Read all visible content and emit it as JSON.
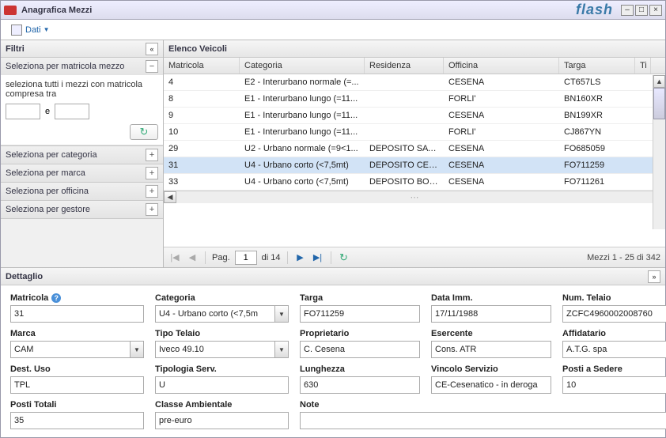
{
  "window": {
    "title": "Anagrafica Mezzi",
    "brand": "flash"
  },
  "toolbar": {
    "dati_label": "Dati"
  },
  "filters": {
    "header": "Filtri",
    "sections": {
      "matricola": {
        "label": "Seleziona per matricola mezzo",
        "desc": "seleziona tutti i mezzi con matricola compresa tra",
        "sep": "e",
        "from": "",
        "to": ""
      },
      "categoria": {
        "label": "Seleziona per categoria"
      },
      "marca": {
        "label": "Seleziona per marca"
      },
      "officina": {
        "label": "Seleziona per officina"
      },
      "gestore": {
        "label": "Seleziona per gestore"
      }
    }
  },
  "grid": {
    "header": "Elenco Veicoli",
    "columns": {
      "matricola": "Matricola",
      "categoria": "Categoria",
      "residenza": "Residenza",
      "officina": "Officina",
      "targa": "Targa",
      "ti": "Ti"
    },
    "rows": [
      {
        "matricola": "4",
        "categoria": "E2 - Interurbano normale (=...",
        "residenza": "",
        "officina": "CESENA",
        "targa": "CT657LS"
      },
      {
        "matricola": "8",
        "categoria": "E1 - Interurbano lungo (=11...",
        "residenza": "",
        "officina": "FORLI'",
        "targa": "BN160XR"
      },
      {
        "matricola": "9",
        "categoria": "E1 - Interurbano lungo (=11...",
        "residenza": "",
        "officina": "CESENA",
        "targa": "BN199XR"
      },
      {
        "matricola": "10",
        "categoria": "E1 - Interurbano lungo (=11...",
        "residenza": "",
        "officina": "FORLI'",
        "targa": "CJ867YN"
      },
      {
        "matricola": "29",
        "categoria": "U2 - Urbano normale (=9<1...",
        "residenza": "DEPOSITO SAVI...",
        "officina": "CESENA",
        "targa": "FO685059"
      },
      {
        "matricola": "31",
        "categoria": "U4 - Urbano corto (<7,5mt)",
        "residenza": "DEPOSITO CESE...",
        "officina": "CESENA",
        "targa": "FO711259"
      },
      {
        "matricola": "33",
        "categoria": "U4 - Urbano corto (<7,5mt)",
        "residenza": "DEPOSITO BORE...",
        "officina": "CESENA",
        "targa": "FO711261"
      }
    ],
    "selected_index": 5,
    "pager": {
      "page_label": "Pag.",
      "page": "1",
      "of_label": "di 14",
      "status": "Mezzi 1 - 25 di 342"
    }
  },
  "detail": {
    "header": "Dettaglio",
    "fields": {
      "matricola": {
        "label": "Matricola",
        "value": "31"
      },
      "categoria": {
        "label": "Categoria",
        "value": "U4 - Urbano corto (<7,5m"
      },
      "targa": {
        "label": "Targa",
        "value": "FO711259"
      },
      "data_imm": {
        "label": "Data Imm.",
        "value": "17/11/1988"
      },
      "num_telaio": {
        "label": "Num. Telaio",
        "value": "ZCFC4960002008760"
      },
      "marca": {
        "label": "Marca",
        "value": "CAM"
      },
      "tipo_telaio": {
        "label": "Tipo Telaio",
        "value": "Iveco 49.10"
      },
      "proprietario": {
        "label": "Proprietario",
        "value": "C. Cesena"
      },
      "esercente": {
        "label": "Esercente",
        "value": "Cons. ATR"
      },
      "affidatario": {
        "label": "Affidatario",
        "value": "A.T.G. spa"
      },
      "dest_uso": {
        "label": "Dest. Uso",
        "value": "TPL"
      },
      "tipologia_serv": {
        "label": "Tipologia Serv.",
        "value": "U"
      },
      "lunghezza": {
        "label": "Lunghezza",
        "value": "630"
      },
      "vincolo_servizio": {
        "label": "Vincolo Servizio",
        "value": "CE-Cesenatico - in deroga"
      },
      "posti_sedere": {
        "label": "Posti a Sedere",
        "value": "10"
      },
      "posti_totali": {
        "label": "Posti Totali",
        "value": "35"
      },
      "classe_ambientale": {
        "label": "Classe Ambientale",
        "value": "pre-euro"
      },
      "note": {
        "label": "Note",
        "value": ""
      }
    }
  }
}
